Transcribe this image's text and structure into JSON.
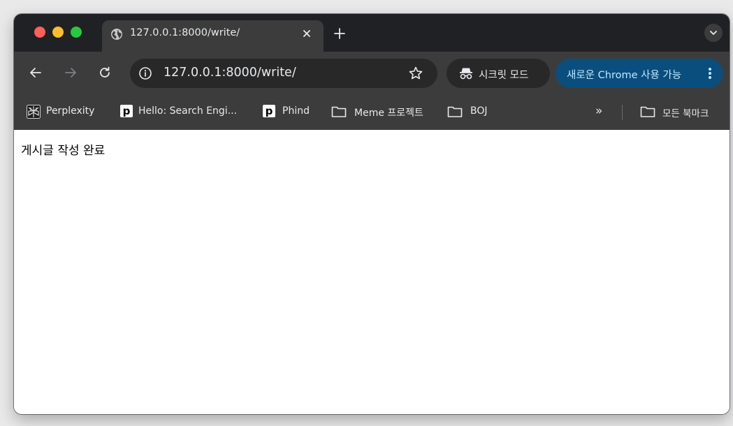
{
  "browser": {
    "tab": {
      "title": "127.0.0.1:8000/write/"
    },
    "address_bar": {
      "url": "127.0.0.1:8000/write/"
    },
    "incognito_label": "시크릿 모드",
    "update_label": "새로운 Chrome 사용 가능",
    "colors": {
      "frame": "#202124",
      "toolbar": "#3c3c3c",
      "omnibox": "#282828",
      "update_chip": "#0a4e7d",
      "close": "#fe5f57",
      "minimize": "#febc2e",
      "maximize": "#28c840"
    }
  },
  "bookmarks": {
    "items": [
      {
        "label": "Perplexity",
        "icon": "perplexity-logo-icon"
      },
      {
        "label": "Hello: Search Engi...",
        "icon": "phind-p-icon"
      },
      {
        "label": "Phind",
        "icon": "phind-p-icon"
      },
      {
        "label": "Meme 프로젝트",
        "icon": "folder-icon"
      },
      {
        "label": "BOJ",
        "icon": "folder-icon"
      }
    ],
    "overflow_label": "»",
    "all_bookmarks_label": "모든 북마크"
  },
  "page": {
    "message": "게시글 작성 완료"
  }
}
